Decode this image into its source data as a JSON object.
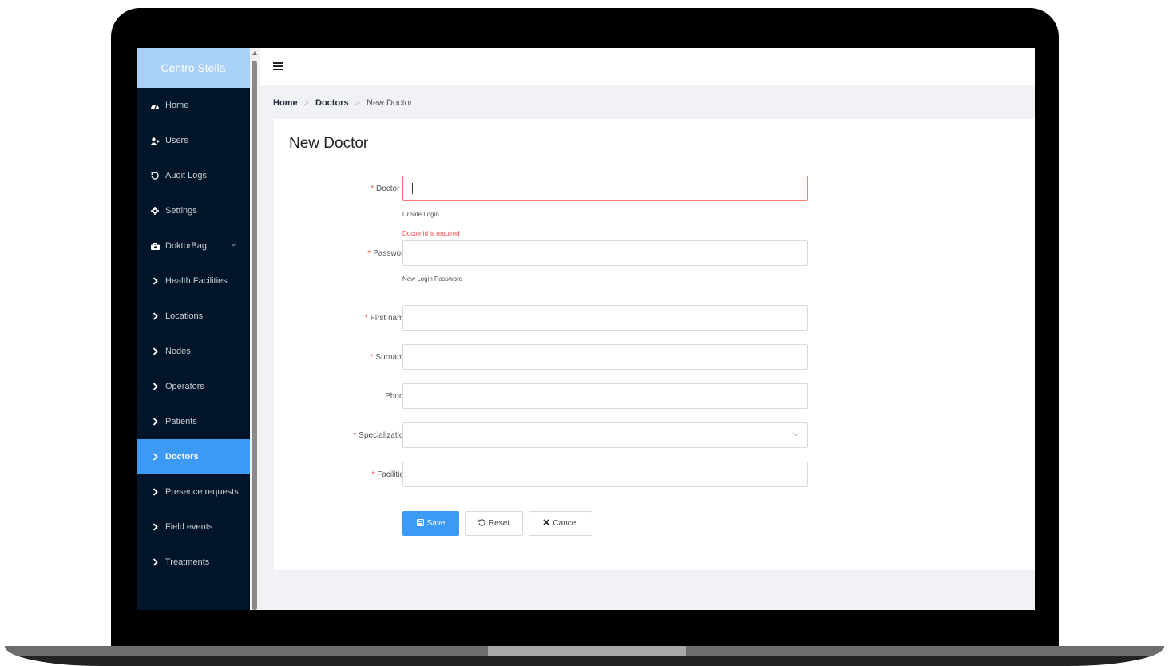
{
  "app": {
    "brand": "Centro Stella"
  },
  "sidebar": {
    "items": [
      {
        "label": "Home",
        "icon": "dashboard-icon"
      },
      {
        "label": "Users",
        "icon": "users-icon"
      },
      {
        "label": "Audit Logs",
        "icon": "history-icon"
      },
      {
        "label": "Settings",
        "icon": "gear-icon"
      },
      {
        "label": "DoktorBag",
        "icon": "bag-icon"
      },
      {
        "label": "Health Facilities",
        "icon": "chevron-right-icon"
      },
      {
        "label": "Locations",
        "icon": "chevron-right-icon"
      },
      {
        "label": "Nodes",
        "icon": "chevron-right-icon"
      },
      {
        "label": "Operators",
        "icon": "chevron-right-icon"
      },
      {
        "label": "Patients",
        "icon": "chevron-right-icon"
      },
      {
        "label": "Doctors",
        "icon": "chevron-right-icon",
        "active": true
      },
      {
        "label": "Presence requests",
        "icon": "chevron-right-icon"
      },
      {
        "label": "Field events",
        "icon": "chevron-right-icon"
      },
      {
        "label": "Treatments",
        "icon": "chevron-right-icon"
      }
    ]
  },
  "breadcrumb": {
    "home": "Home",
    "section": "Doctors",
    "current": "New Doctor"
  },
  "page": {
    "title": "New Doctor"
  },
  "form": {
    "doctor_id": {
      "label": "Doctor id",
      "value": "",
      "help": "Create Login",
      "error": "Doctor id is required"
    },
    "password": {
      "label": "Password",
      "value": "",
      "help": "New Login Password"
    },
    "first_name": {
      "label": "First name",
      "value": ""
    },
    "surname": {
      "label": "Surname",
      "value": ""
    },
    "phone": {
      "label": "Phone",
      "value": ""
    },
    "specialization": {
      "label": "Specialization",
      "value": ""
    },
    "facilities": {
      "label": "Facilities",
      "value": ""
    }
  },
  "buttons": {
    "save": "Save",
    "reset": "Reset",
    "cancel": "Cancel"
  },
  "colors": {
    "sidebar_bg": "#001529",
    "accent": "#3c99f6",
    "brand_bg": "#a8d0f8",
    "error": "#ff4d4f"
  }
}
